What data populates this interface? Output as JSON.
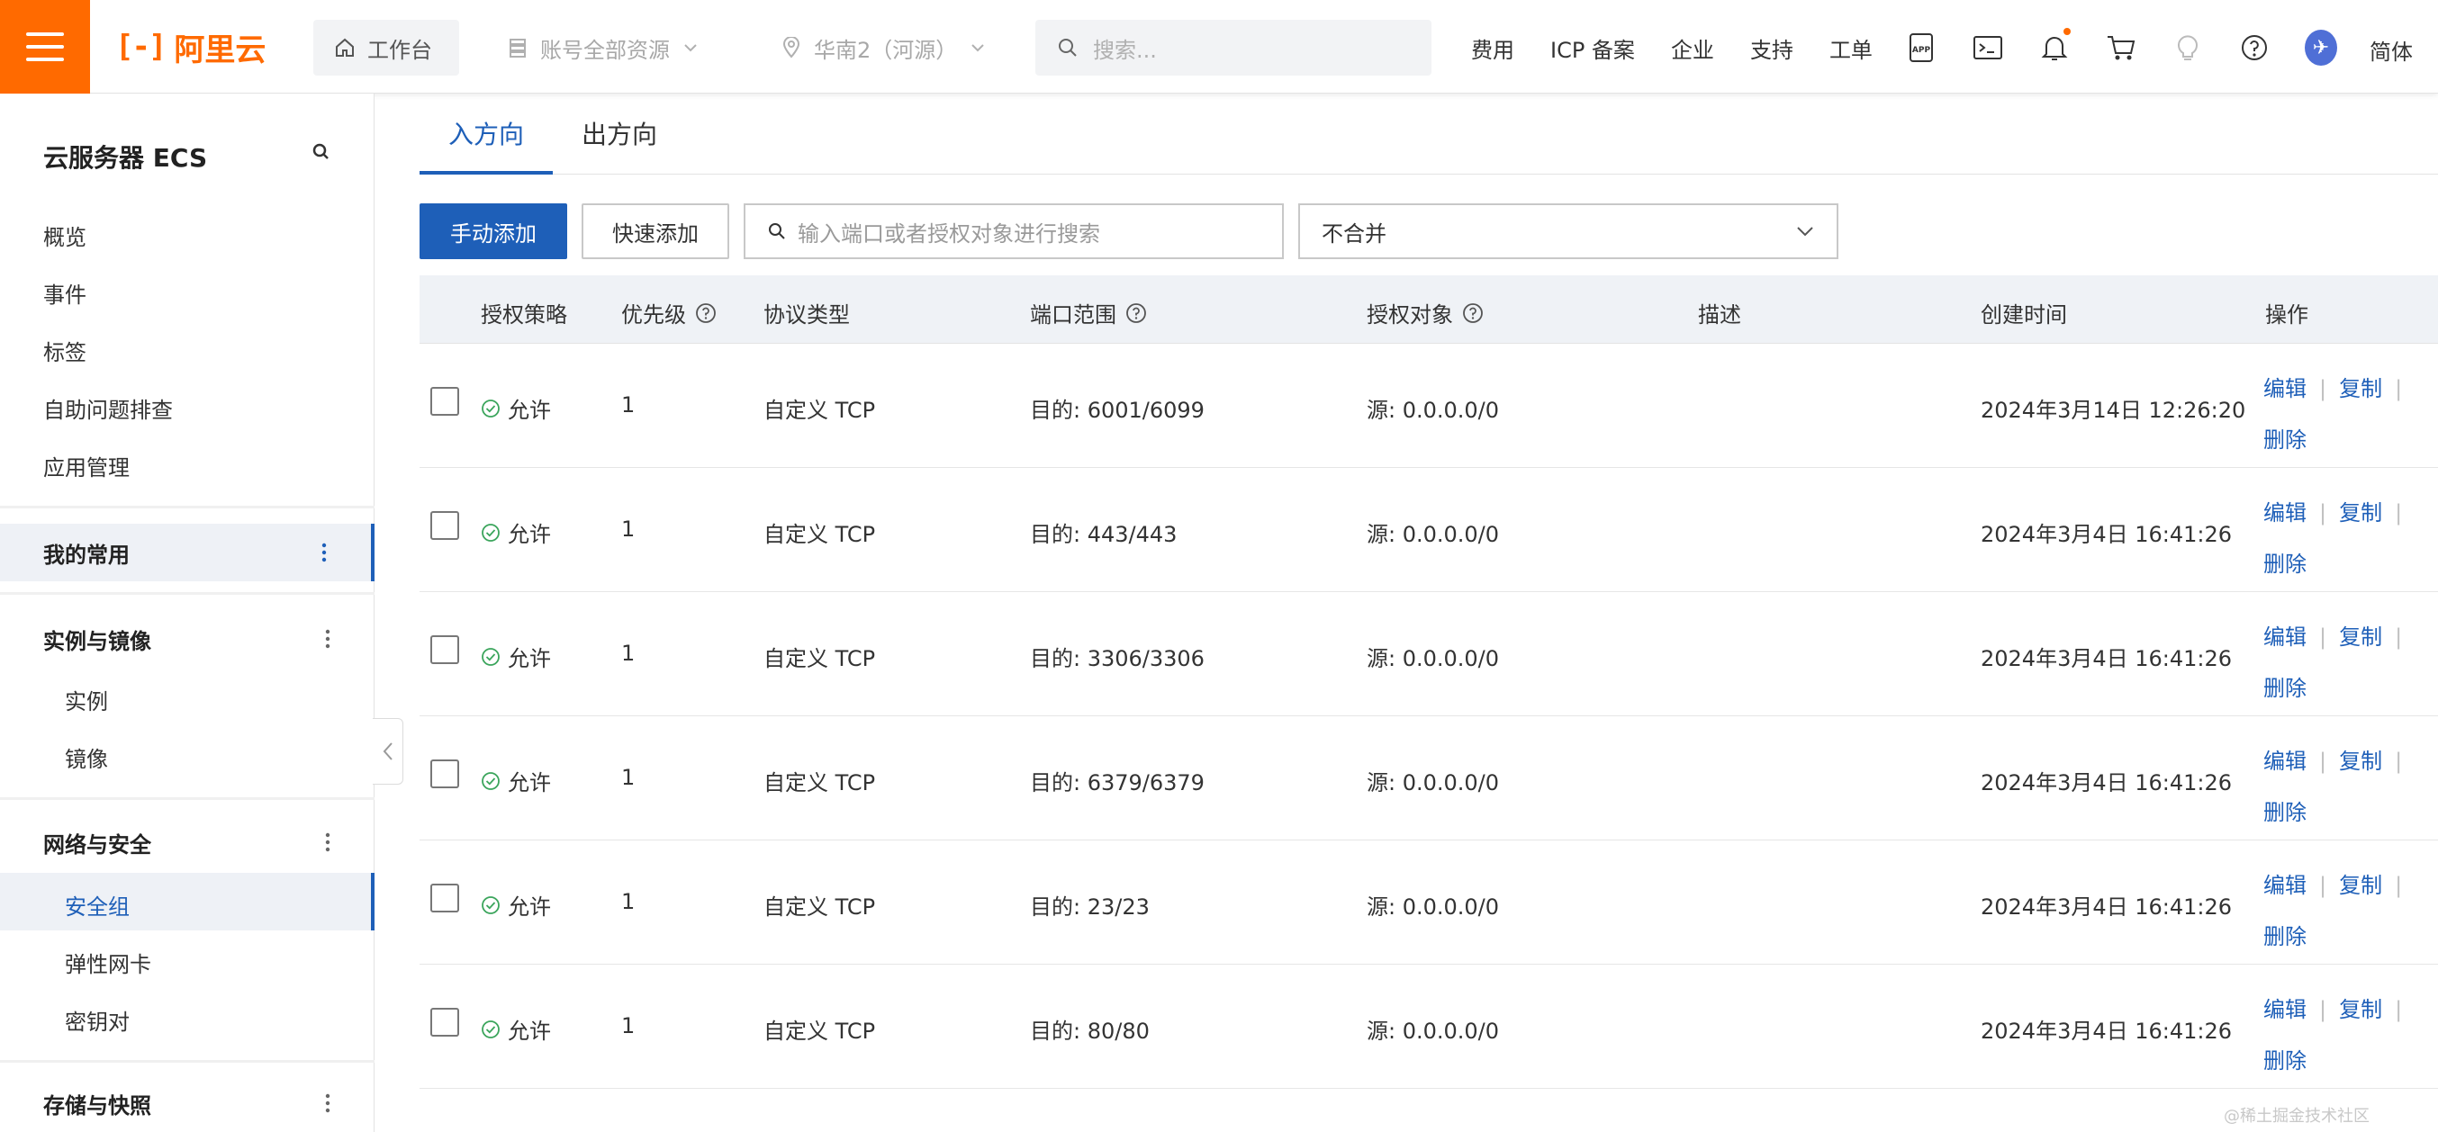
{
  "topbar": {
    "brand": "阿里云",
    "brand_mark": "[-]",
    "workbench": "工作台",
    "resources": "账号全部资源",
    "region": "华南2（河源）",
    "search_placeholder": "搜索...",
    "links": [
      "费用",
      "ICP 备案",
      "企业",
      "支持",
      "工单"
    ],
    "app_icon_text": "APP",
    "lang": "简体",
    "accent": "#ff6a00"
  },
  "sidebar": {
    "title": "云服务器 ECS",
    "items": [
      "概览",
      "事件",
      "标签",
      "自助问题排查",
      "应用管理"
    ],
    "my_common": "我的常用",
    "instances_group": "实例与镜像",
    "instances_items": [
      "实例",
      "镜像"
    ],
    "network_group": "网络与安全",
    "network_items": [
      "安全组",
      "弹性网卡",
      "密钥对"
    ],
    "storage_group": "存储与快照",
    "active_item": "安全组"
  },
  "tabs": [
    "入方向",
    "出方向"
  ],
  "toolbar": {
    "add_manual": "手动添加",
    "add_quick": "快速添加",
    "search_placeholder": "输入端口或者授权对象进行搜索",
    "merge_select": "不合并"
  },
  "table": {
    "columns": [
      "授权策略",
      "优先级",
      "协议类型",
      "端口范围",
      "授权对象",
      "描述",
      "创建时间",
      "操作"
    ],
    "actions": [
      "编辑",
      "复制",
      "删除"
    ],
    "rows": [
      {
        "policy": "允许",
        "priority": "1",
        "protocol": "自定义 TCP",
        "port": "目的: 6001/6099",
        "source": "源: 0.0.0.0/0",
        "desc": "",
        "created": "2024年3月14日 12:26:20"
      },
      {
        "policy": "允许",
        "priority": "1",
        "protocol": "自定义 TCP",
        "port": "目的: 443/443",
        "source": "源: 0.0.0.0/0",
        "desc": "",
        "created": "2024年3月4日 16:41:26"
      },
      {
        "policy": "允许",
        "priority": "1",
        "protocol": "自定义 TCP",
        "port": "目的: 3306/3306",
        "source": "源: 0.0.0.0/0",
        "desc": "",
        "created": "2024年3月4日 16:41:26"
      },
      {
        "policy": "允许",
        "priority": "1",
        "protocol": "自定义 TCP",
        "port": "目的: 6379/6379",
        "source": "源: 0.0.0.0/0",
        "desc": "",
        "created": "2024年3月4日 16:41:26"
      },
      {
        "policy": "允许",
        "priority": "1",
        "protocol": "自定义 TCP",
        "port": "目的: 23/23",
        "source": "源: 0.0.0.0/0",
        "desc": "",
        "created": "2024年3月4日 16:41:26"
      },
      {
        "policy": "允许",
        "priority": "1",
        "protocol": "自定义 TCP",
        "port": "目的: 80/80",
        "source": "源: 0.0.0.0/0",
        "desc": "",
        "created": "2024年3月4日 16:41:26"
      }
    ]
  },
  "watermark": "@稀土掘金技术社区"
}
